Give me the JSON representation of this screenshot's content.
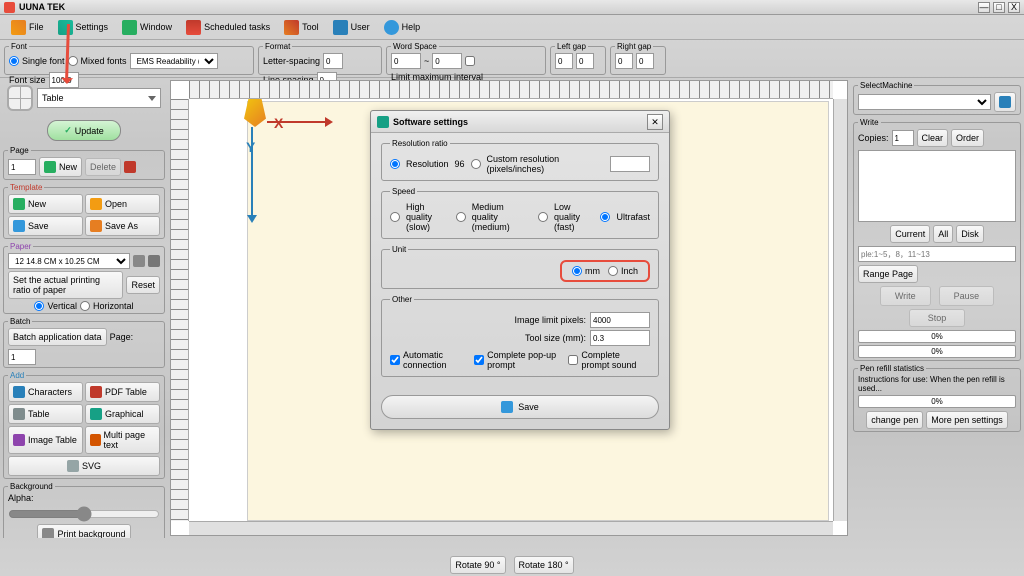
{
  "app": {
    "title": "UUNA TEK"
  },
  "menu": {
    "file": "File",
    "settings": "Settings",
    "window": "Window",
    "sched": "Scheduled tasks",
    "tool": "Tool",
    "user": "User",
    "help": "Help"
  },
  "font": {
    "legend": "Font",
    "single": "Single font",
    "mixed": "Mixed fonts",
    "family": "EMS Readability (20…",
    "size_label": "Font size",
    "size": "100.0"
  },
  "format": {
    "legend": "Format",
    "letter": "Letter-spacing",
    "letter_v": "0",
    "line": "Line spacing",
    "line_v": "0"
  },
  "wordspace": {
    "legend": "Word Space",
    "a": "0",
    "b": "0",
    "limit": "Limit maximum interval"
  },
  "leftgap": {
    "legend": "Left gap",
    "a": "0",
    "b": "0"
  },
  "rightgap": {
    "legend": "Right gap",
    "a": "0",
    "b": "0"
  },
  "table": {
    "label": "Table",
    "update": "Update"
  },
  "page": {
    "legend": "Page",
    "num": "1",
    "new": "New",
    "delete": "Delete"
  },
  "template": {
    "legend": "Template",
    "new": "New",
    "open": "Open",
    "save": "Save",
    "saveas": "Save As"
  },
  "paper": {
    "legend": "Paper",
    "size": "12 14.8 CM x 10.25 CM",
    "set": "Set the actual printing ratio of paper",
    "reset": "Reset",
    "vert": "Vertical",
    "horiz": "Horizontal"
  },
  "batch": {
    "legend": "Batch",
    "app": "Batch application data",
    "page": "Page:",
    "num": "1"
  },
  "add": {
    "legend": "Add",
    "chars": "Characters",
    "pdf": "PDF Table",
    "table": "Table",
    "graph": "Graphical",
    "img": "Image Table",
    "multi": "Multi page text",
    "svg": "SVG"
  },
  "bg": {
    "legend": "Background",
    "alpha": "Alpha:",
    "print": "Print background"
  },
  "axis": {
    "x": "X",
    "y": "Y"
  },
  "dialog": {
    "title": "Software settings",
    "res": {
      "legend": "Resolution ratio",
      "res": "Resolution",
      "res_v": "96",
      "custom": "Custom resolution (pixels/inches)",
      "custom_v": ""
    },
    "speed": {
      "legend": "Speed",
      "hq": "High quality (slow)",
      "mq": "Medium quality (medium)",
      "lq": "Low quality (fast)",
      "uf": "Ultrafast"
    },
    "unit": {
      "legend": "Unit",
      "mm": "mm",
      "inch": "Inch"
    },
    "other": {
      "legend": "Other",
      "ilp": "Image limit pixels:",
      "ilp_v": "4000",
      "ts": "Tool size (mm):",
      "ts_v": "0.3",
      "auto": "Automatic connection",
      "popup": "Complete pop-up prompt",
      "sound": "Complete prompt sound"
    },
    "save": "Save"
  },
  "right": {
    "machine": {
      "legend": "SelectMachine"
    },
    "write": {
      "legend": "Write",
      "copies": "Copies:",
      "copies_v": "1",
      "clear": "Clear",
      "order": "Order",
      "current": "Current",
      "all": "All",
      "disk": "Disk",
      "range_ph": "ple:1~5，8，11~13",
      "range_btn": "Range Page",
      "wbtn": "Write",
      "pause": "Pause",
      "stop": "Stop",
      "p0": "0%",
      "p1": "0%"
    },
    "pen": {
      "legend": "Pen refill statistics",
      "instr": "Instructions for use: When the pen refill is used...",
      "pct": "0%",
      "change": "change pen",
      "more": "More pen settings"
    }
  },
  "footer": {
    "r90": "Rotate 90 °",
    "r180": "Rotate 180 °"
  }
}
